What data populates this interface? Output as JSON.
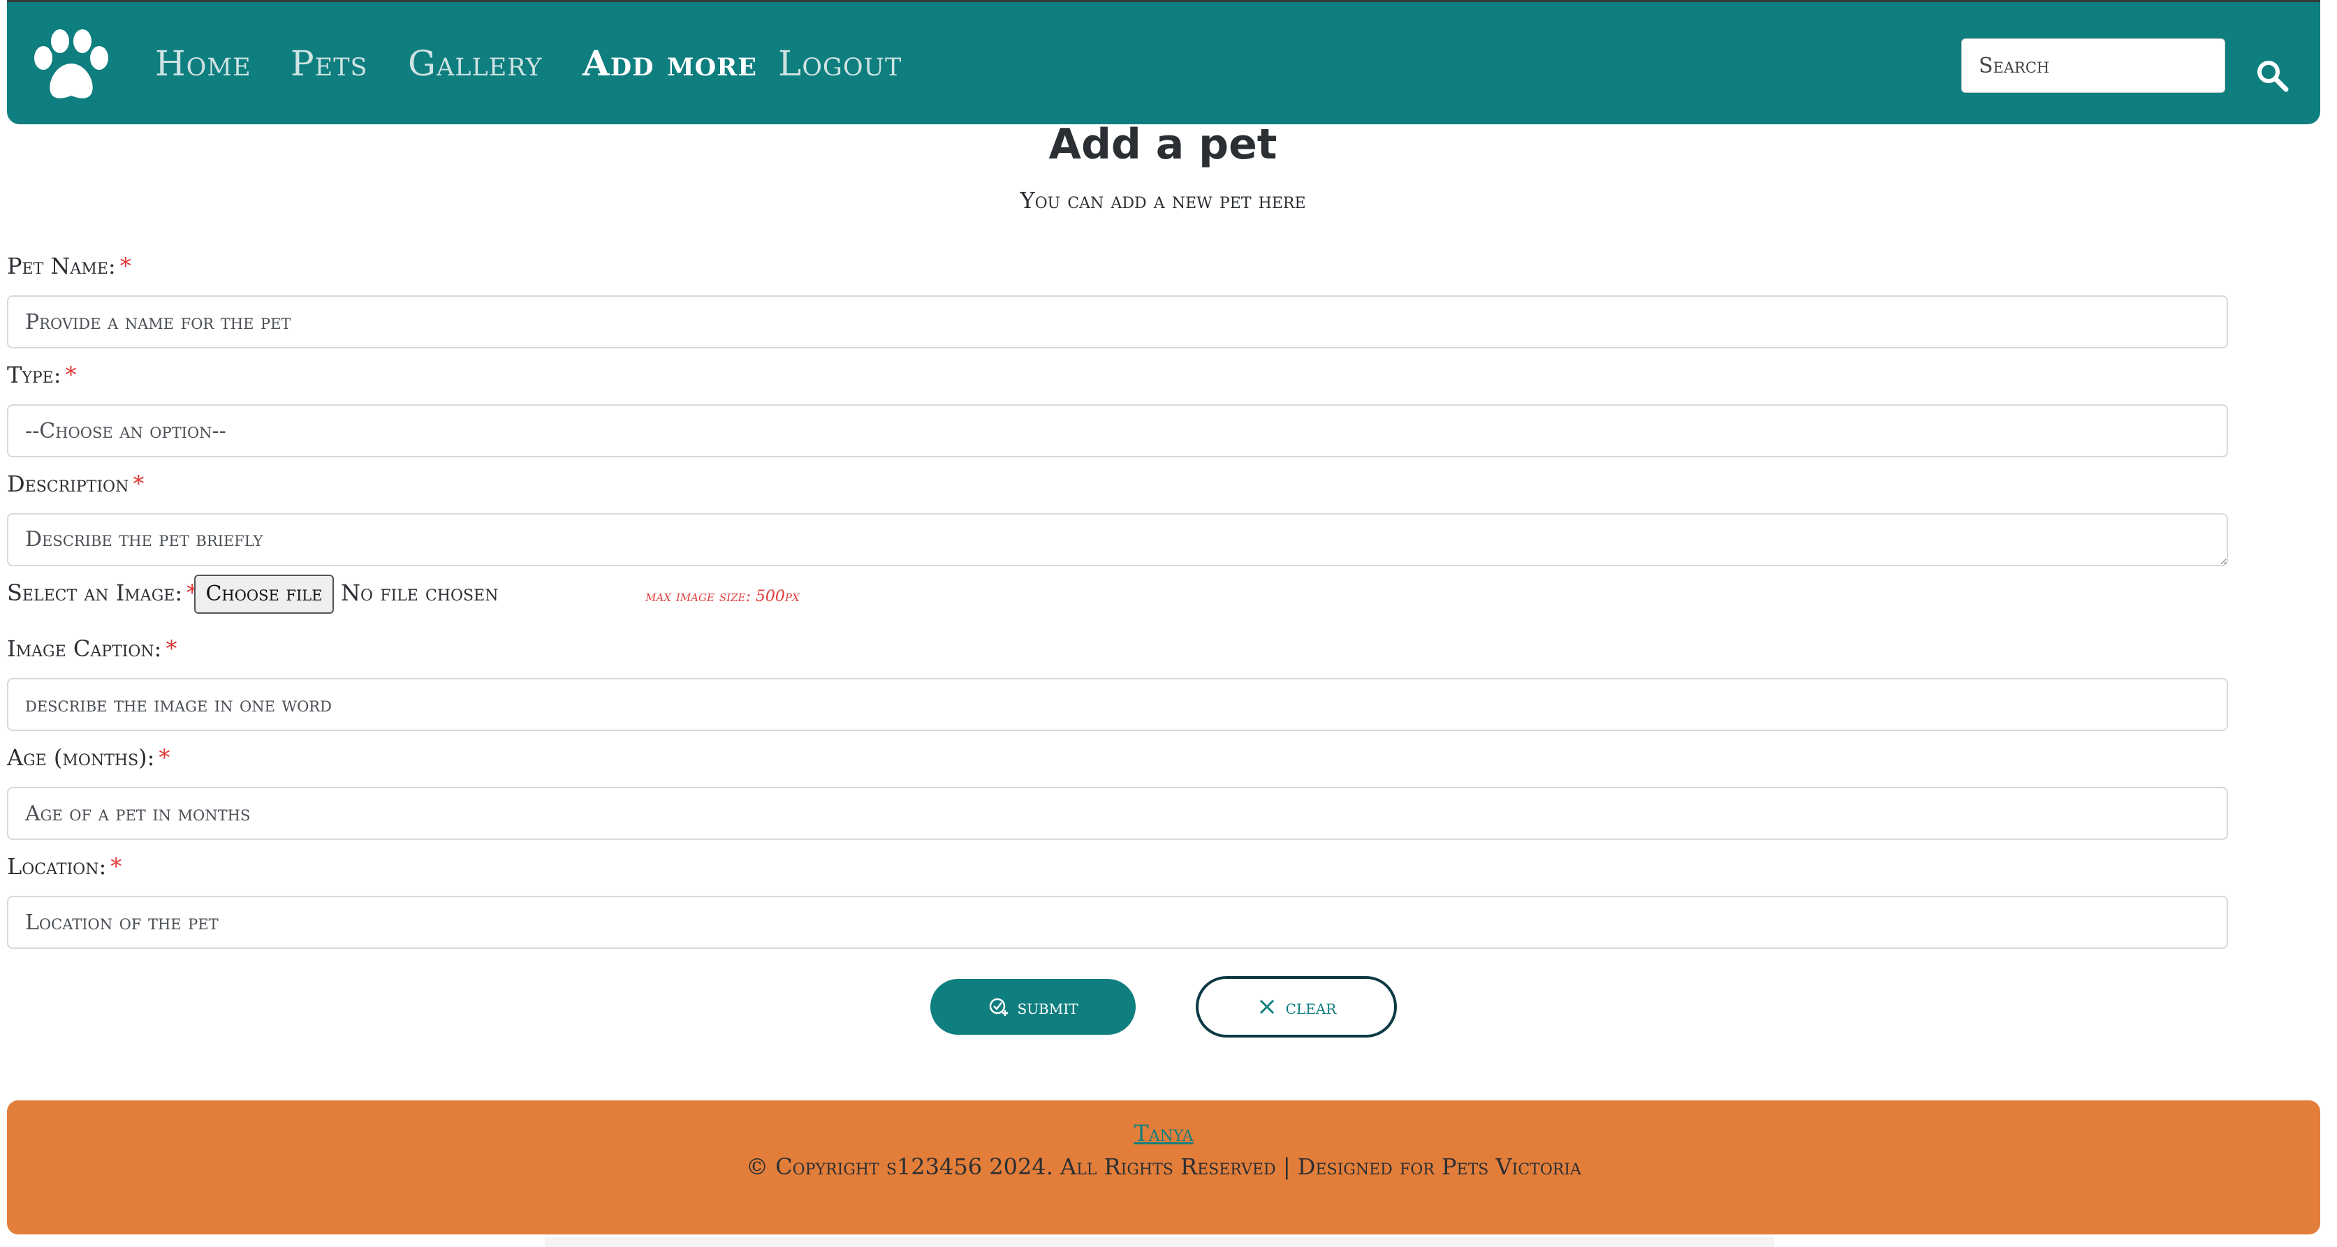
{
  "nav": {
    "items": [
      {
        "label": "Home",
        "active": false
      },
      {
        "label": "Pets",
        "active": false
      },
      {
        "label": "Gallery",
        "active": false
      },
      {
        "label": "Add more",
        "active": true
      },
      {
        "label": "Logout",
        "active": false
      }
    ],
    "search_placeholder": "Search",
    "logo_icon": "paw-icon",
    "search_icon": "search-icon"
  },
  "page": {
    "title": "Add a pet",
    "subtitle": "You can add a new pet here"
  },
  "form": {
    "required_mark": "*",
    "pet_name": {
      "label": "Pet Name:",
      "placeholder": "Provide a name for the pet"
    },
    "type": {
      "label": "Type:",
      "selected": "--Choose an option--"
    },
    "description": {
      "label": "Description",
      "placeholder": "Describe the pet briefly"
    },
    "image": {
      "label": "Select an Image:",
      "button": "Choose file",
      "status": "No file chosen",
      "note": "max image size: 500px"
    },
    "caption": {
      "label": "Image Caption:",
      "placeholder": "describe the image in one word"
    },
    "age": {
      "label": "Age (months):",
      "placeholder": "Age of a pet in months"
    },
    "location": {
      "label": "Location:",
      "placeholder": "Location of the pet"
    },
    "submit_label": "submit",
    "clear_label": "clear"
  },
  "footer": {
    "link": "Tanya",
    "copyright": "© Copyright s123456 2024. All Rights Reserved | Designed for Pets Victoria"
  },
  "colors": {
    "primary": "#0f7e7f",
    "footer": "#e37e3a",
    "required": "#e03b3b",
    "text": "#2b2f33"
  }
}
